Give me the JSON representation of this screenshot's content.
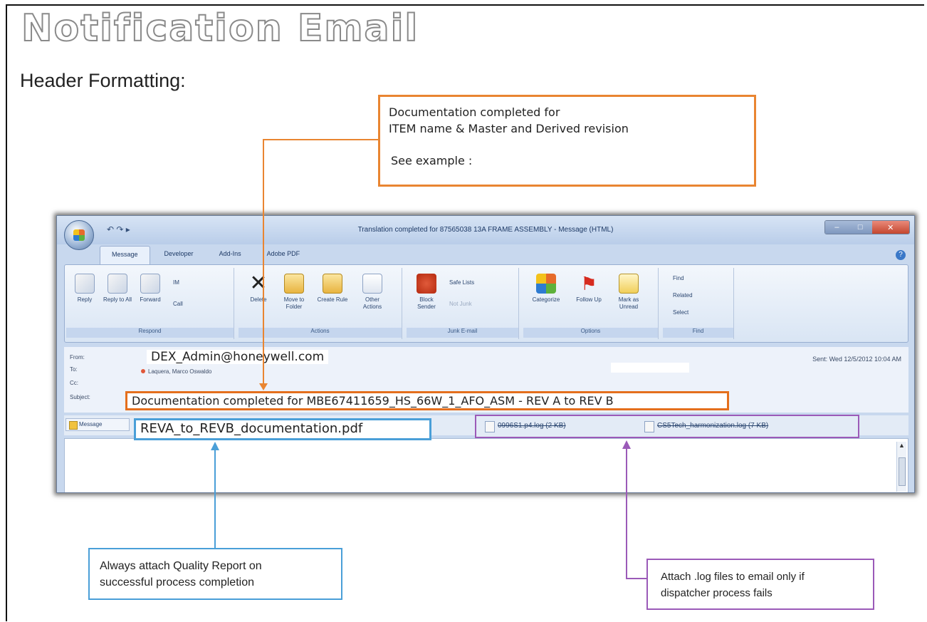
{
  "slide": {
    "title": "Notification Email",
    "subtitle": "Header Formatting:"
  },
  "callouts": {
    "top": {
      "line1": "Documentation completed for",
      "line2": "ITEM name & Master and Derived revision",
      "line3": "See example :"
    },
    "quality": {
      "line1": "Always attach Quality Report on",
      "line2": "successful process completion"
    },
    "logs": {
      "line1": "Attach .log files to email only if",
      "line2": "dispatcher process fails"
    }
  },
  "outlook": {
    "window_title": "Translation completed for 87565038 13A FRAME ASSEMBLY - Message (HTML)",
    "qat": "↶ ↷ ▸",
    "tabs": [
      "Message",
      "Developer",
      "Add-Ins",
      "Adobe PDF"
    ],
    "ribbon": {
      "respond": {
        "label": "Respond",
        "reply": "Reply",
        "reply_all": "Reply to All",
        "forward": "Forward",
        "im": "IM",
        "call": "Call"
      },
      "actions": {
        "label": "Actions",
        "delete": "Delete",
        "move": "Move to Folder",
        "rule": "Create Rule",
        "other": "Other Actions"
      },
      "junk": {
        "label": "Junk E-mail",
        "block": "Block Sender",
        "safe": "Safe Lists",
        "not_junk": "Not Junk"
      },
      "options": {
        "label": "Options",
        "categorize": "Categorize",
        "follow": "Follow Up",
        "mark": "Mark as Unread"
      },
      "find": {
        "label": "Find",
        "find": "Find",
        "related": "Related",
        "select": "Select"
      }
    },
    "header": {
      "from_label": "From:",
      "to_label": "To:",
      "cc_label": "Cc:",
      "subject_label": "Subject:",
      "from": "DEX_Admin@honeywell.com",
      "to": "Laquera, Marco Oswaldo",
      "sent": "Sent: Wed 12/5/2012 10:04 AM",
      "subject": "Documentation completed for MBE67411659_HS_66W_1_AFO_ASM - REV A to REV B"
    },
    "attachments": {
      "message_tab": "Message",
      "pdf": "REVA_to_REVB_documentation.pdf",
      "log1": "0996S1.p4.log (2 KB)",
      "log2": "CS5Tech_harmonization.log (7 KB)"
    }
  },
  "colors": {
    "orange": "#e46f1d",
    "blue": "#4a9fd8",
    "purple": "#9b5ab8"
  }
}
